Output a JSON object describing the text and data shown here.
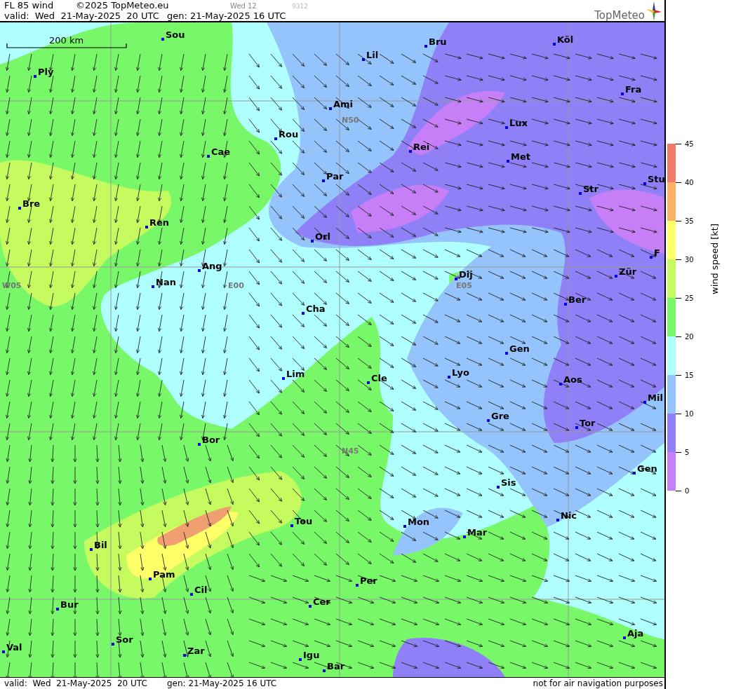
{
  "header": {
    "title": "FL 85 wind",
    "copyright": "©2025 TopMeteo.eu",
    "day_code": "Wed 12",
    "run_code": "9312",
    "valid": "valid:  Wed  21-May-2025  20 UTC",
    "generated": "gen: 21-May-2025 16 UTC",
    "logo": "TopMeteo"
  },
  "map": {
    "scale": "200 km",
    "grid_labels": [
      "N50",
      "W05",
      "E00",
      "E05",
      "N45"
    ],
    "cities": [
      "Sou",
      "Ply",
      "Lil",
      "Bru",
      "Köl",
      "Ami",
      "Fra",
      "Rou",
      "Lux",
      "Cae",
      "Rei",
      "Met",
      "Par",
      "Str",
      "Stu",
      "Bre",
      "Ren",
      "Orl",
      "F",
      "Ang",
      "Nan",
      "Dij",
      "Zür",
      "Cha",
      "Ber",
      "Gen",
      "Lim",
      "Cle",
      "Lyo",
      "Aos",
      "Mil",
      "Gre",
      "Tor",
      "Bor",
      "Gen",
      "Sis",
      "Nic",
      "Mon",
      "Tou",
      "Mar",
      "Bil",
      "Pam",
      "Cil",
      "Per",
      "Cer",
      "Bur",
      "Sor",
      "Aja",
      "Val",
      "Zar",
      "Igu",
      "Bar"
    ]
  },
  "legend": {
    "label": "wind speed [kt]",
    "ticks": [
      "45",
      "40",
      "35",
      "30",
      "25",
      "20",
      "15",
      "10",
      "5",
      "0"
    ],
    "bands": [
      {
        "color": "#f27a68"
      },
      {
        "color": "#fcb068"
      },
      {
        "color": "#ffff68"
      },
      {
        "color": "#c6fb60"
      },
      {
        "color": "#78f868"
      },
      {
        "color": "#b0ffff"
      },
      {
        "color": "#94c4fb"
      },
      {
        "color": "#8f80f7"
      },
      {
        "color": "#c77ff7"
      }
    ]
  },
  "footer": {
    "valid": "valid:  Wed  21-May-2025  20 UTC",
    "generated": "gen: 21-May-2025 16 UTC",
    "disclaimer": "not for air navigation purposes"
  }
}
